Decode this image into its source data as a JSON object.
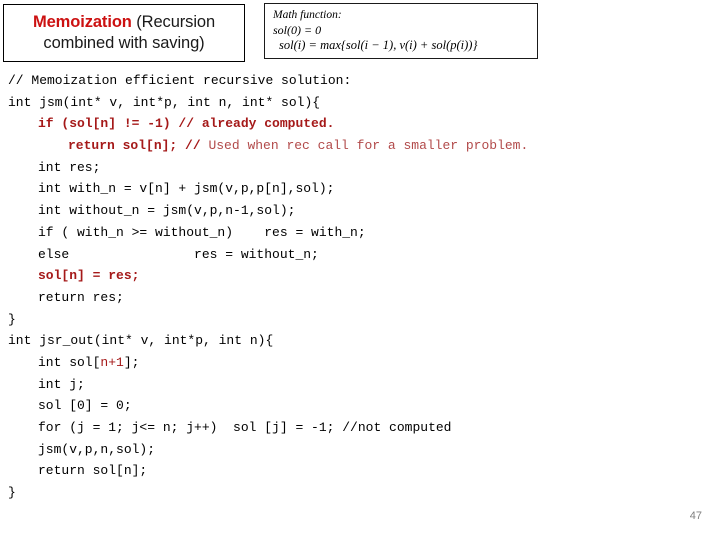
{
  "title_box": {
    "line1_strong": "Memoization",
    "line1_rest": " (Recursion",
    "line2": "combined with saving)",
    "accent_color": "#cc1111"
  },
  "math_box": {
    "heading": "Math function:",
    "line2": "sol(0) = 0",
    "line3": "sol(i) = max{sol(i − 1), v(i) + sol(p(i))}"
  },
  "code": {
    "language": "c",
    "colors": {
      "black": "#000000",
      "red_bold": "#a51919",
      "red_light": "#b24a4a"
    },
    "lines": [
      {
        "indent": 0,
        "spans": [
          {
            "t": "// Memoization efficient recursive solution:",
            "c": "blk"
          }
        ]
      },
      {
        "indent": 0,
        "spans": [
          {
            "t": "int jsm(int* v, int*p, int n, int* sol){",
            "c": "blk"
          }
        ]
      },
      {
        "indent": 1,
        "spans": [
          {
            "t": "if (sol[n] != -1) // already computed.",
            "c": "red-b"
          }
        ]
      },
      {
        "indent": 2,
        "spans": [
          {
            "t": "return sol[n]; ",
            "c": "red-b"
          },
          {
            "t": "// ",
            "c": "red-b"
          },
          {
            "t": "Used when rec call for a smaller problem.",
            "c": "red-l"
          }
        ]
      },
      {
        "indent": 1,
        "spans": [
          {
            "t": "int res;",
            "c": "blk"
          }
        ]
      },
      {
        "indent": 1,
        "spans": [
          {
            "t": "int with_n = v[n] + jsm(v,p,p[n],sol);",
            "c": "blk"
          }
        ]
      },
      {
        "indent": 1,
        "spans": [
          {
            "t": "int without_n = jsm(v,p,n-1,sol);",
            "c": "blk"
          }
        ]
      },
      {
        "indent": 1,
        "spans": [
          {
            "t": "if ( with_n >= without_n)    res = with_n;",
            "c": "blk"
          }
        ]
      },
      {
        "indent": 1,
        "spans": [
          {
            "t": "else                res = without_n;",
            "c": "blk"
          }
        ]
      },
      {
        "indent": 1,
        "spans": [
          {
            "t": "sol[n] = res;",
            "c": "red-b"
          }
        ]
      },
      {
        "indent": 1,
        "spans": [
          {
            "t": "return res;",
            "c": "blk"
          }
        ]
      },
      {
        "indent": 0,
        "spans": [
          {
            "t": "}",
            "c": "blk"
          }
        ]
      },
      {
        "indent": 0,
        "spans": [
          {
            "t": "int jsr_out(int* v, int*p, int n){",
            "c": "blk"
          }
        ]
      },
      {
        "indent": 1,
        "spans": [
          {
            "t": "int sol[",
            "c": "blk"
          },
          {
            "t": "n+1",
            "c": "red-n"
          },
          {
            "t": "];",
            "c": "blk"
          }
        ]
      },
      {
        "indent": 1,
        "spans": [
          {
            "t": "int j;",
            "c": "blk"
          }
        ]
      },
      {
        "indent": 1,
        "spans": [
          {
            "t": "sol [0] = 0;",
            "c": "blk"
          }
        ]
      },
      {
        "indent": 1,
        "spans": [
          {
            "t": "for (j = 1; j<= n; j++)  sol [j] = -1; //not computed",
            "c": "blk"
          }
        ]
      },
      {
        "indent": 1,
        "spans": [
          {
            "t": "jsm(v,p,n,sol);",
            "c": "blk"
          }
        ]
      },
      {
        "indent": 1,
        "spans": [
          {
            "t": "return sol[n];",
            "c": "blk"
          }
        ]
      },
      {
        "indent": 0,
        "spans": [
          {
            "t": "}",
            "c": "blk"
          }
        ]
      }
    ]
  },
  "footer": {
    "page_number": "47"
  }
}
